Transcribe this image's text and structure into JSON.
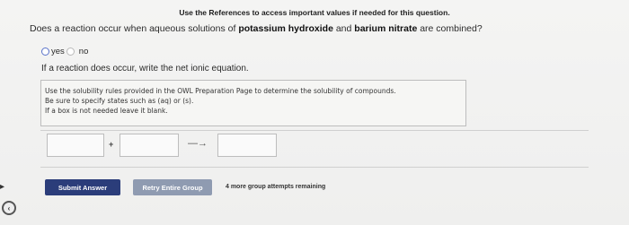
{
  "references_notice": "Use the References to access important values if needed for this question.",
  "question": {
    "prefix": "Does a reaction occur when aqueous solutions of ",
    "reactant1": "potassium hydroxide",
    "middle": " and ",
    "reactant2": "barium nitrate",
    "suffix": " are combined?"
  },
  "options": {
    "yes": "yes",
    "no": "no"
  },
  "instruction": "If a reaction does occur, write the net ionic equation.",
  "hints": [
    "Use the solubility rules provided in the OWL Preparation Page to determine the solubility of compounds.",
    "Be sure to specify states such as (aq) or (s).",
    "If a box is not needed leave it blank."
  ],
  "equation": {
    "plus": "+",
    "arrow": "—→"
  },
  "buttons": {
    "submit": "Submit Answer",
    "retry": "Retry Entire Group"
  },
  "attempts_remaining": "4 more group attempts remaining",
  "edge_arrow": "▸",
  "corner_icon_glyph": "‹"
}
